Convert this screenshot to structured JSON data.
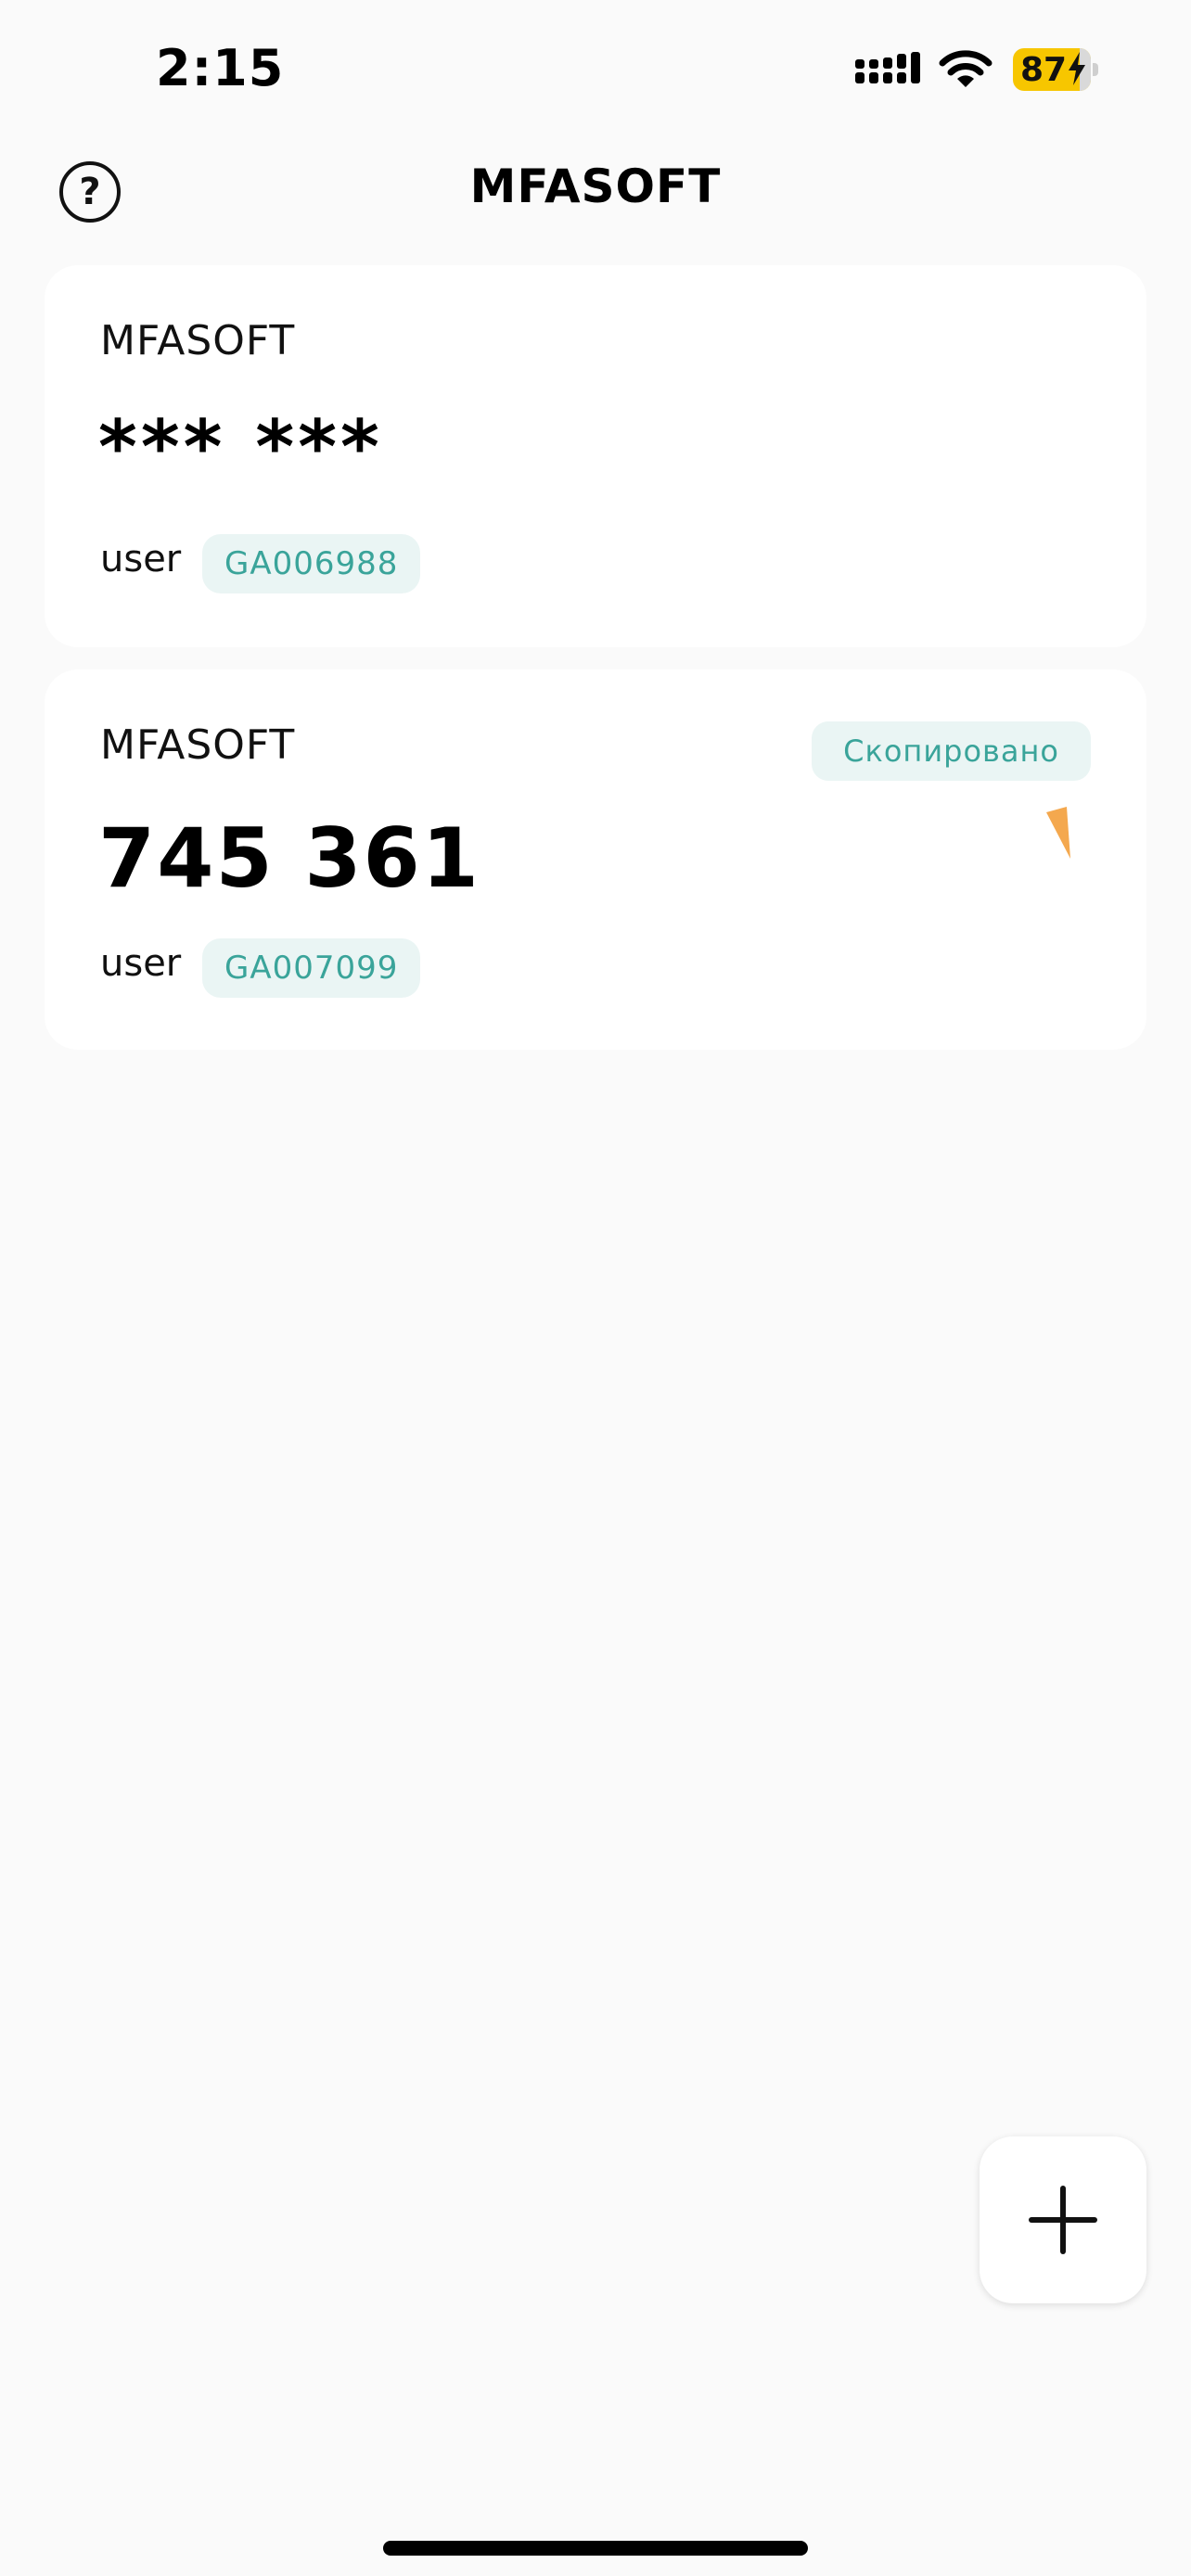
{
  "status_bar": {
    "time": "2:15",
    "battery_level": "87",
    "icons": [
      "signal-icon",
      "wifi-icon",
      "battery-charging-icon"
    ]
  },
  "header": {
    "title": "MFASOFT",
    "help_icon": "question-circle-icon",
    "help_glyph": "?"
  },
  "tokens": [
    {
      "issuer": "MFASOFT",
      "code": "*** ***",
      "account": "user",
      "token_id": "GA006988"
    },
    {
      "issuer": "MFASOFT",
      "code": "745 361",
      "account": "user",
      "token_id": "GA007099",
      "status": "Скопировано",
      "timer_icon": "countdown-timer-icon"
    }
  ],
  "add_button_icon": "plus-icon",
  "colors": {
    "background": "#fafafa",
    "card": "#ffffff",
    "accent": "#3aa49a",
    "badge_bg": "#eaf5f4",
    "battery": "#f7c600",
    "timer": "#f4a84e"
  }
}
